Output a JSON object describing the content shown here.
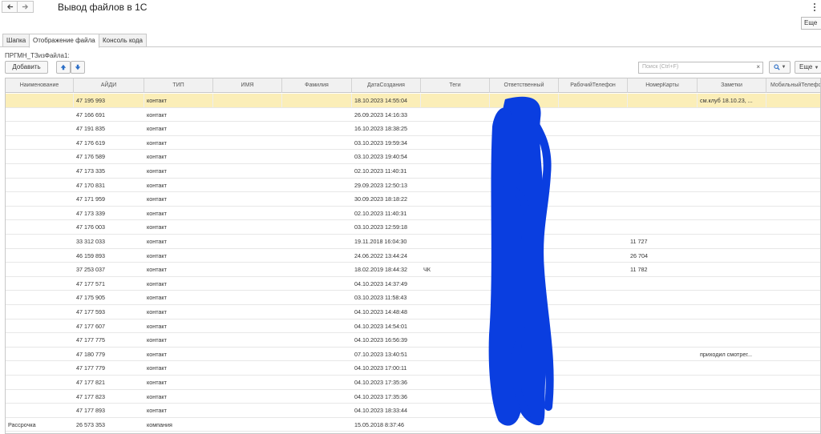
{
  "window": {
    "title": "Вывод файлов в 1С",
    "more_label": "Еще"
  },
  "tabs": [
    "Шапка",
    "Отображение файла",
    "Консоль кода"
  ],
  "active_tab": 1,
  "section_label": "ПРГМН_ТЗизФайла1:",
  "toolbar": {
    "add_label": "Добавить",
    "search_placeholder": "Поиск (Ctrl+F)",
    "search_clear": "×",
    "more_label": "Еще"
  },
  "columns": [
    "Наименование",
    "АЙДИ",
    "ТИП",
    "ИМЯ",
    "Фамилия",
    "ДатаСоздания",
    "Теги",
    "Ответственный",
    "РабочийТелефон",
    "НомерКарты",
    "Заметки",
    "МобильныйТелефон"
  ],
  "rows": [
    {
      "name": "",
      "id": "47 195 993",
      "type": "контакт",
      "date": "18.10.2023 14:55:04",
      "tags": "",
      "card": "",
      "notes": "см.клуб 18.10.23, ..."
    },
    {
      "name": "",
      "id": "47 166 691",
      "type": "контакт",
      "date": "26.09.2023 14:16:33",
      "tags": "",
      "card": "",
      "notes": ""
    },
    {
      "name": "",
      "id": "47 191 835",
      "type": "контакт",
      "date": "16.10.2023 18:38:25",
      "tags": "",
      "card": "",
      "notes": ""
    },
    {
      "name": "",
      "id": "47 176 619",
      "type": "контакт",
      "date": "03.10.2023 19:59:34",
      "tags": "",
      "card": "",
      "notes": ""
    },
    {
      "name": "",
      "id": "47 176 589",
      "type": "контакт",
      "date": "03.10.2023 19:40:54",
      "tags": "",
      "card": "",
      "notes": ""
    },
    {
      "name": "",
      "id": "47 173 335",
      "type": "контакт",
      "date": "02.10.2023 11:40:31",
      "tags": "",
      "card": "",
      "notes": ""
    },
    {
      "name": "",
      "id": "47 170 831",
      "type": "контакт",
      "date": "29.09.2023 12:50:13",
      "tags": "",
      "card": "",
      "notes": ""
    },
    {
      "name": "",
      "id": "47 171 959",
      "type": "контакт",
      "date": "30.09.2023 18:18:22",
      "tags": "",
      "card": "",
      "notes": ""
    },
    {
      "name": "",
      "id": "47 173 339",
      "type": "контакт",
      "date": "02.10.2023 11:40:31",
      "tags": "",
      "card": "",
      "notes": ""
    },
    {
      "name": "",
      "id": "47 176 003",
      "type": "контакт",
      "date": "03.10.2023 12:59:18",
      "tags": "",
      "card": "",
      "notes": ""
    },
    {
      "name": "",
      "id": "33 312 033",
      "type": "контакт",
      "date": "19.11.2018 16:04:30",
      "tags": "",
      "card": "11 727",
      "notes": ""
    },
    {
      "name": "",
      "id": "46 159 893",
      "type": "контакт",
      "date": "24.06.2022 13:44:24",
      "tags": "",
      "card": "26 704",
      "notes": ""
    },
    {
      "name": "",
      "id": "37 253 037",
      "type": "контакт",
      "date": "18.02.2019 18:44:32",
      "tags": "ЧК",
      "card": "11 782",
      "notes": ""
    },
    {
      "name": "",
      "id": "47 177 571",
      "type": "контакт",
      "date": "04.10.2023 14:37:49",
      "tags": "",
      "card": "",
      "notes": ""
    },
    {
      "name": "",
      "id": "47 175 905",
      "type": "контакт",
      "date": "03.10.2023 11:58:43",
      "tags": "",
      "card": "",
      "notes": ""
    },
    {
      "name": "",
      "id": "47 177 593",
      "type": "контакт",
      "date": "04.10.2023 14:48:48",
      "tags": "",
      "card": "",
      "notes": ""
    },
    {
      "name": "",
      "id": "47 177 607",
      "type": "контакт",
      "date": "04.10.2023 14:54:01",
      "tags": "",
      "card": "",
      "notes": ""
    },
    {
      "name": "",
      "id": "47 177 775",
      "type": "контакт",
      "date": "04.10.2023 16:56:39",
      "tags": "",
      "card": "",
      "notes": ""
    },
    {
      "name": "",
      "id": "47 180 779",
      "type": "контакт",
      "date": "07.10.2023 13:40:51",
      "tags": "",
      "card": "",
      "notes": "приходил смотрег..."
    },
    {
      "name": "",
      "id": "47 177 779",
      "type": "контакт",
      "date": "04.10.2023 17:00:11",
      "tags": "",
      "card": "",
      "notes": ""
    },
    {
      "name": "",
      "id": "47 177 821",
      "type": "контакт",
      "date": "04.10.2023 17:35:36",
      "tags": "",
      "card": "",
      "notes": ""
    },
    {
      "name": "",
      "id": "47 177 823",
      "type": "контакт",
      "date": "04.10.2023 17:35:36",
      "tags": "",
      "card": "",
      "notes": ""
    },
    {
      "name": "",
      "id": "47 177 893",
      "type": "контакт",
      "date": "04.10.2023 18:33:44",
      "tags": "",
      "card": "",
      "notes": ""
    },
    {
      "name": "Рассрочка",
      "id": "26 573 353",
      "type": "компания",
      "date": "15.05.2018 8:37:46",
      "tags": "",
      "card": "",
      "notes": ""
    }
  ],
  "colors": {
    "selected_row": "#fbeeb8",
    "arrow_blue": "#2d6fc6",
    "scribble": "#0a3ee0"
  }
}
